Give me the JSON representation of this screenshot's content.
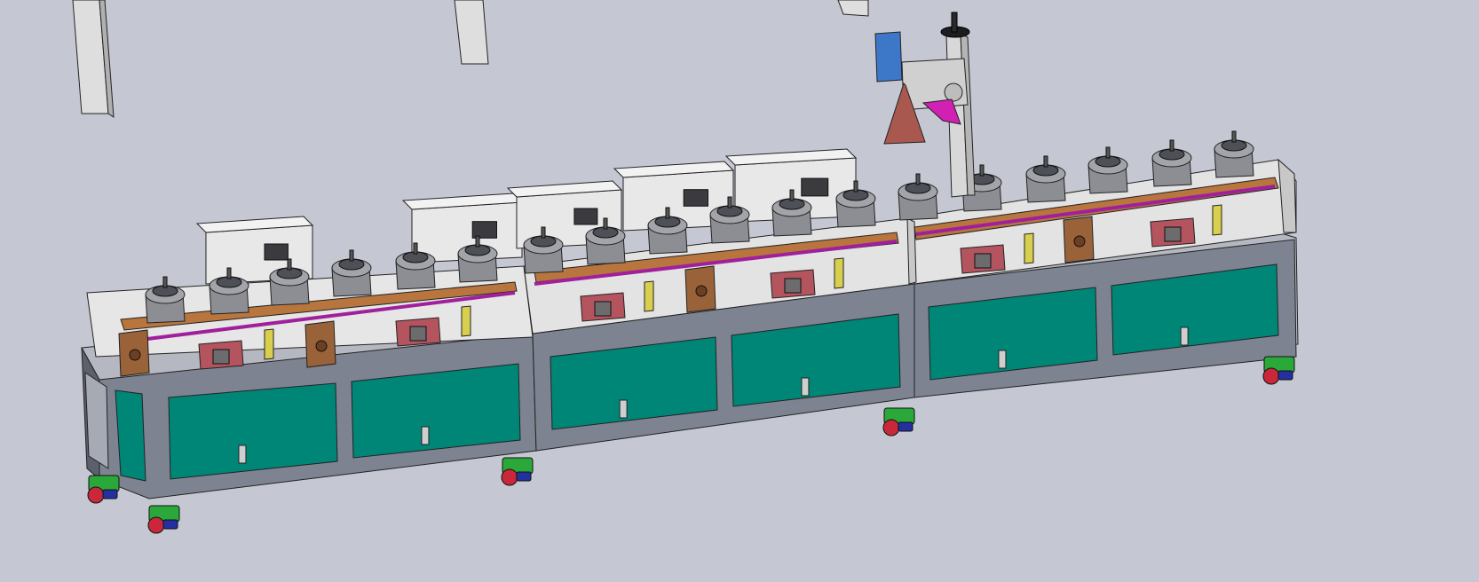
{
  "viewport": {
    "background": "#c5c8d2",
    "content": "cad-render-no-visible-text"
  },
  "palette": {
    "frame": "#7e8391",
    "frame_dark": "#5b606c",
    "frame_light": "#a6aab5",
    "door": "#008676",
    "door_light": "#1fa594",
    "cover": "#dadada",
    "cover_dark": "#b9bbbf",
    "plate": "#b8753d",
    "rail": "#a0209c",
    "fixture": "#b4545f",
    "block": "#9a6238",
    "motor": "#8d8e94",
    "motor_dark": "#4e5058",
    "yellow": "#d8cf4e",
    "caster_green": "#2aa83a",
    "caster_red": "#c8283a",
    "caster_blue": "#2530a0",
    "laser_cone": "#a8584e",
    "laser_head": "#3d78c8",
    "magenta": "#d21fb4"
  },
  "icons": {
    "caster": "caster-wheel-icon",
    "handle": "door-handle-icon"
  }
}
